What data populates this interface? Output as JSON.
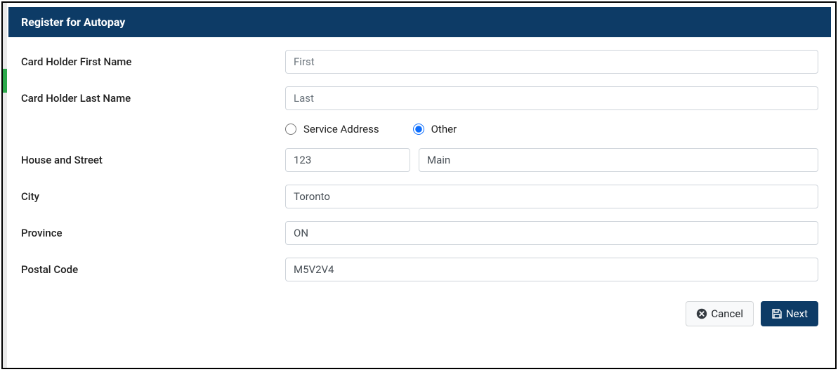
{
  "header": {
    "title": "Register for Autopay"
  },
  "form": {
    "first_name": {
      "label": "Card Holder First Name",
      "placeholder": "First",
      "value": ""
    },
    "last_name": {
      "label": "Card Holder Last Name",
      "placeholder": "Last",
      "value": ""
    },
    "address_type": {
      "service": {
        "label": "Service Address",
        "selected": false
      },
      "other": {
        "label": "Other",
        "selected": true
      }
    },
    "house_street": {
      "label": "House and Street",
      "house_value": "123",
      "street_value": "Main"
    },
    "city": {
      "label": "City",
      "value": "Toronto"
    },
    "province": {
      "label": "Province",
      "value": "ON"
    },
    "postal_code": {
      "label": "Postal Code",
      "value": "M5V2V4"
    }
  },
  "footer": {
    "cancel_label": "Cancel",
    "next_label": "Next"
  }
}
